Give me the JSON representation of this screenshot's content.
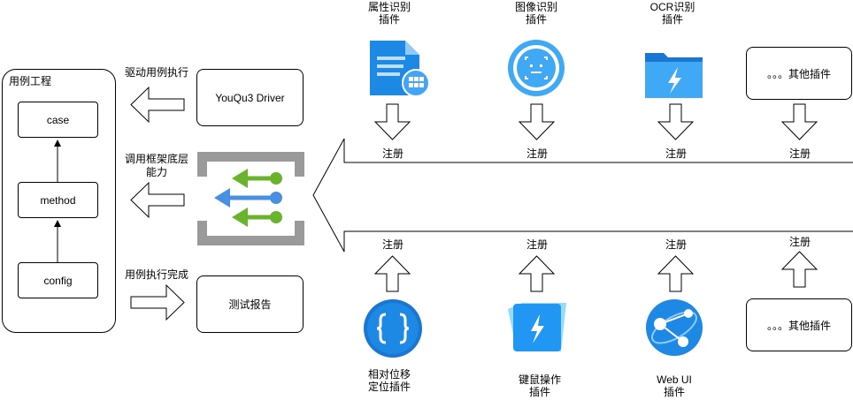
{
  "left_panel": {
    "title": "用例工程",
    "nodes": {
      "case": "case",
      "method": "method",
      "config": "config"
    }
  },
  "middle": {
    "driver_box": "YouQu3 Driver",
    "report_box": "测试报告",
    "arrow_driver_label": "驱动用例执行",
    "arrow_framework_label_1": "调用框架底层",
    "arrow_framework_label_2": "能力",
    "arrow_report_label": "用例执行完成"
  },
  "top_plugins": [
    {
      "name": "attr-plugin",
      "line1": "属性识别",
      "line2": "插件",
      "register": "注册"
    },
    {
      "name": "image-plugin",
      "line1": "图像识别",
      "line2": "插件",
      "register": "注册"
    },
    {
      "name": "ocr-plugin",
      "line1": "OCR识别",
      "line2": "插件",
      "register": "注册"
    },
    {
      "name": "other-top-plugin",
      "box": "。。。其他插件",
      "register": "注册"
    }
  ],
  "bottom_plugins": [
    {
      "name": "relpos-plugin",
      "line1": "相对位移",
      "line2": "定位插件",
      "register": "注册"
    },
    {
      "name": "keymouse-plugin",
      "line1": "键鼠操作",
      "line2": "插件",
      "register": "注册"
    },
    {
      "name": "webui-plugin",
      "line1": "Web UI",
      "line2": "插件",
      "register": "注册"
    },
    {
      "name": "other-bottom-plugin",
      "box": "。。。其他插件",
      "register": "注册"
    }
  ],
  "colors": {
    "blue_icon": "#1e88e5",
    "light_blue": "#3fa9f5",
    "green": "#6ab42d",
    "gray": "#8c8c8c"
  }
}
